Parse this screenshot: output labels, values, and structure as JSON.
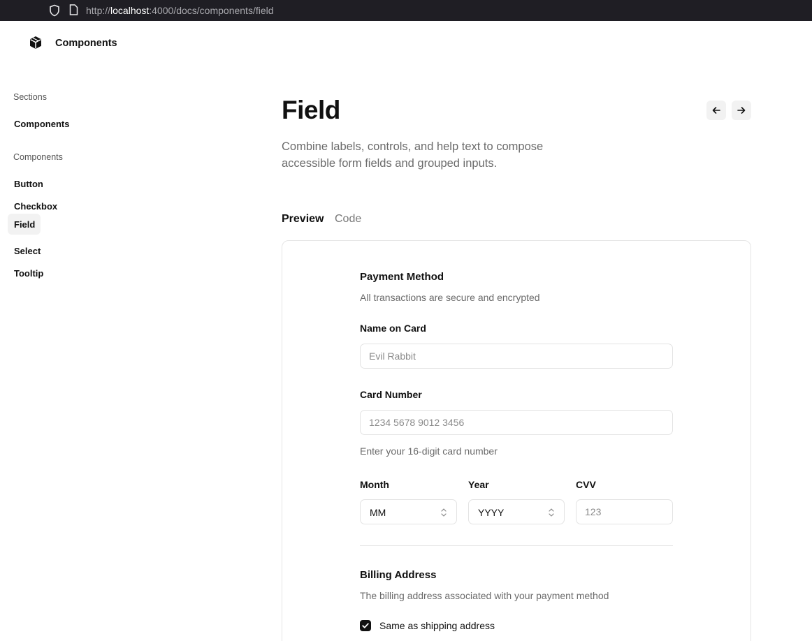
{
  "browser": {
    "url_scheme": "http://",
    "url_host": "localhost",
    "url_rest": ":4000/docs/components/field"
  },
  "header": {
    "app_name": "Components",
    "logo_icon": "box-icon"
  },
  "sidebar": {
    "sections_heading": "Sections",
    "sections_items": [
      {
        "label": "Components"
      }
    ],
    "components_heading": "Components",
    "components_items": [
      {
        "label": "Button"
      },
      {
        "label": "Checkbox"
      },
      {
        "label": "Field",
        "active": true
      },
      {
        "label": "Select"
      },
      {
        "label": "Tooltip"
      }
    ]
  },
  "page": {
    "title": "Field",
    "description": "Combine labels, controls, and help text to compose accessible form fields and grouped inputs.",
    "prev_icon": "arrow-left-icon",
    "next_icon": "arrow-right-icon"
  },
  "tabs": [
    {
      "label": "Preview",
      "active": true
    },
    {
      "label": "Code",
      "active": false
    }
  ],
  "preview": {
    "payment": {
      "legend": "Payment Method",
      "description": "All transactions are secure and encrypted",
      "name_label": "Name on Card",
      "name_placeholder": "Evil Rabbit",
      "card_label": "Card Number",
      "card_placeholder": "1234 5678 9012 3456",
      "card_help": "Enter your 16-digit card number",
      "month_label": "Month",
      "month_value": "MM",
      "year_label": "Year",
      "year_value": "YYYY",
      "cvv_label": "CVV",
      "cvv_placeholder": "123"
    },
    "billing": {
      "legend": "Billing Address",
      "description": "The billing address associated with your payment method",
      "same_as_shipping_label": "Same as shipping address",
      "same_as_shipping_checked": true
    }
  }
}
